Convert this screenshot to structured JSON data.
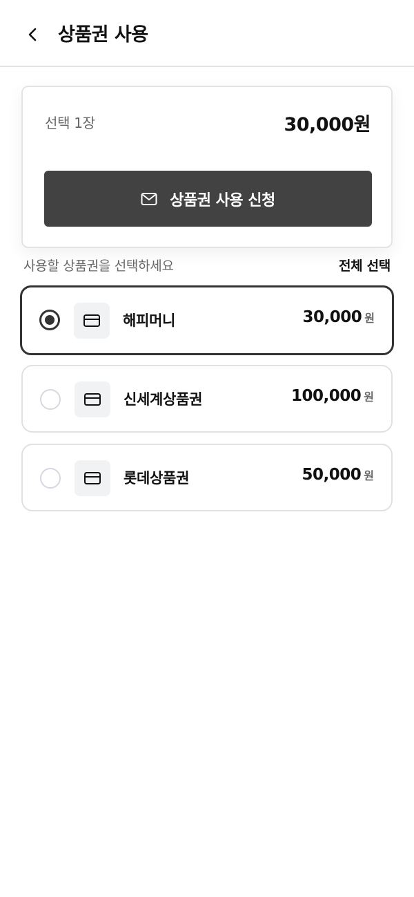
{
  "header": {
    "back_icon": "chevron-left-icon",
    "title": "상품권 사용"
  },
  "summary": {
    "selected_label": "선택 1장",
    "total_amount": "30,000원",
    "apply_button": {
      "icon": "mail-icon",
      "label": "상품권 사용 신청"
    }
  },
  "list": {
    "hint": "사용할 상품권을 선택하세요",
    "select_all": "전체 선택",
    "items": [
      {
        "name": "해피머니",
        "amount": "30,000",
        "unit": "원",
        "selected": true,
        "icon": "card-icon"
      },
      {
        "name": "신세계상품권",
        "amount": "100,000",
        "unit": "원",
        "selected": false,
        "icon": "card-icon"
      },
      {
        "name": "롯데상품권",
        "amount": "50,000",
        "unit": "원",
        "selected": false,
        "icon": "card-icon"
      }
    ]
  },
  "colors": {
    "button_bg": "#424242",
    "selected_border": "#333333",
    "muted_text": "#666666",
    "icon_box_bg": "#f1f2f4"
  }
}
